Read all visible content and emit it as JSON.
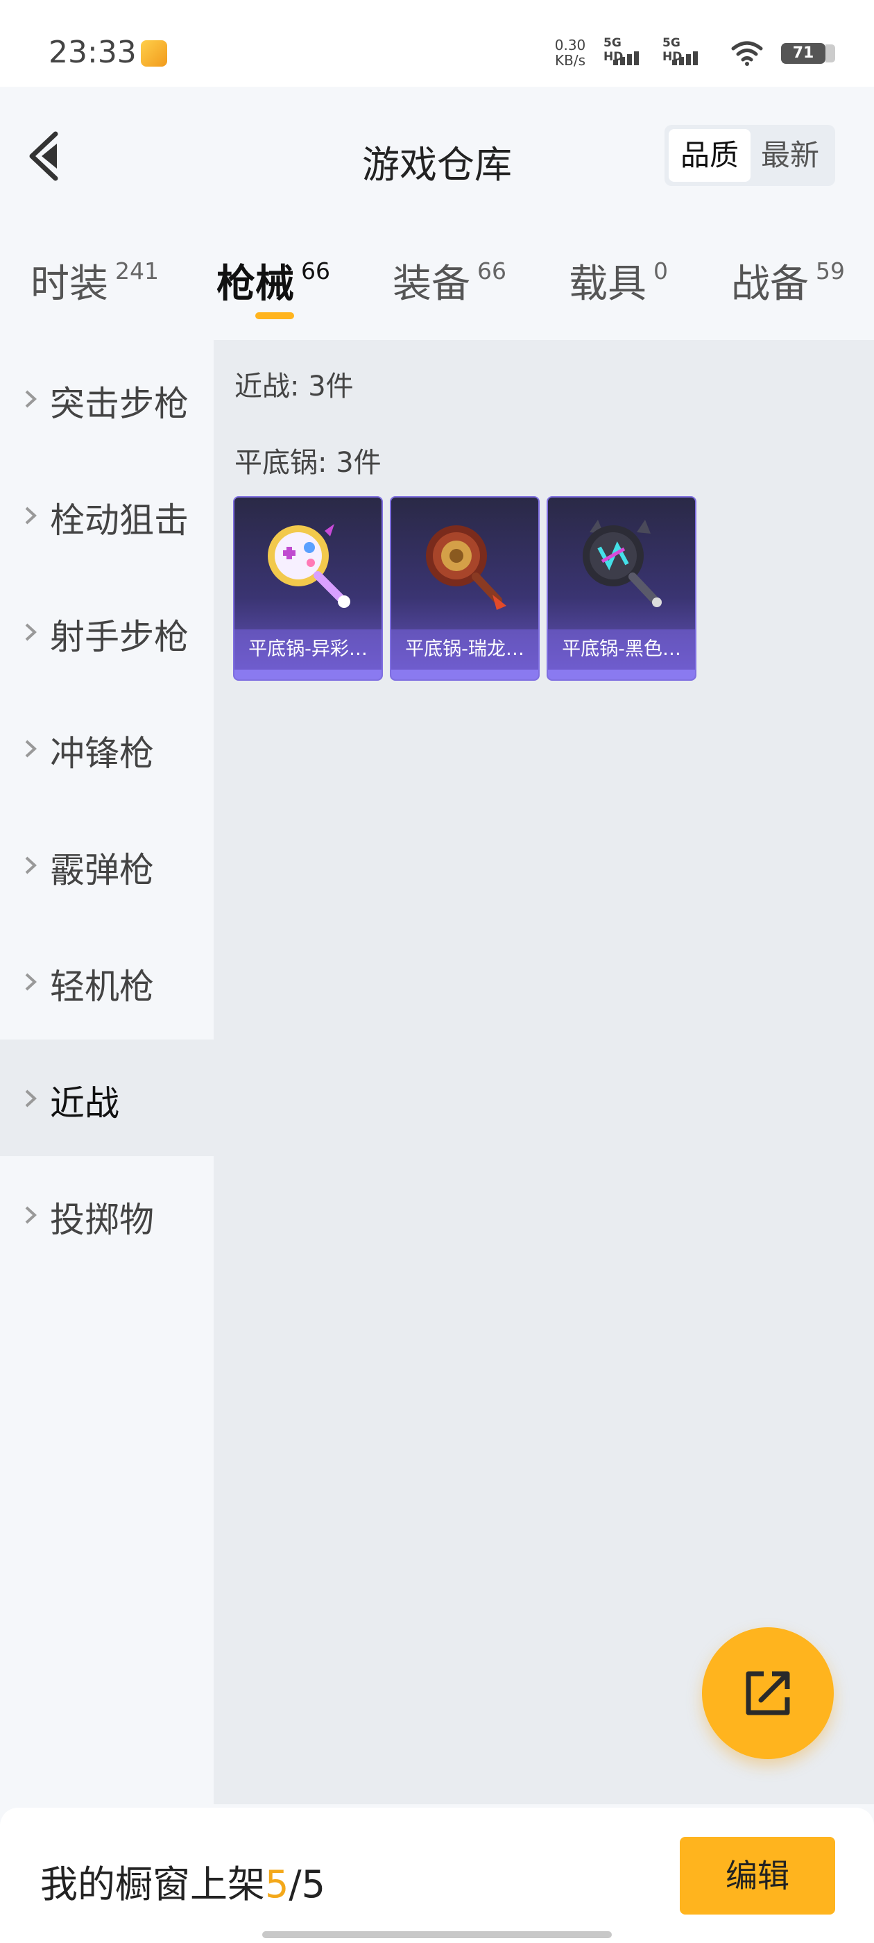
{
  "status_bar": {
    "time": "23:33",
    "net_speed": "0.30",
    "net_speed_unit": "KB/s",
    "sim1_label": "5G HD",
    "sim2_label": "5G HD",
    "battery": "71"
  },
  "header": {
    "title": "游戏仓库",
    "sort_options": [
      "品质",
      "最新"
    ],
    "active_sort": "品质"
  },
  "tabs": [
    {
      "label": "时装",
      "count": "241"
    },
    {
      "label": "枪械",
      "count": "66",
      "active": true
    },
    {
      "label": "装备",
      "count": "66"
    },
    {
      "label": "载具",
      "count": "0"
    },
    {
      "label": "战备",
      "count": "59"
    }
  ],
  "sidebar": {
    "items": [
      {
        "label": "突击步枪"
      },
      {
        "label": "栓动狙击"
      },
      {
        "label": "射手步枪"
      },
      {
        "label": "冲锋枪"
      },
      {
        "label": "霰弹枪"
      },
      {
        "label": "轻机枪"
      },
      {
        "label": "近战",
        "active": true
      },
      {
        "label": "投掷物"
      }
    ]
  },
  "main": {
    "category_summary": "近战: 3件",
    "subcategory_summary": "平底锅: 3件",
    "items": [
      {
        "name": "平底锅-异彩…",
        "icon": "frying-pan-colorful-icon"
      },
      {
        "name": "平底锅-瑞龙…",
        "icon": "frying-pan-dragon-icon"
      },
      {
        "name": "平底锅-黑色…",
        "icon": "frying-pan-black-icon"
      }
    ]
  },
  "fab": {
    "icon": "share-icon"
  },
  "bottom_bar": {
    "showcase_label": "我的橱窗上架",
    "showcase_current": "5",
    "showcase_separator": "/",
    "showcase_total": "5",
    "edit_label": "编辑"
  },
  "colors": {
    "accent": "#ffb41e",
    "item_card_bg": "#3a3472",
    "page_bg": "#f5f7fa",
    "content_bg": "#e9ecf0"
  }
}
